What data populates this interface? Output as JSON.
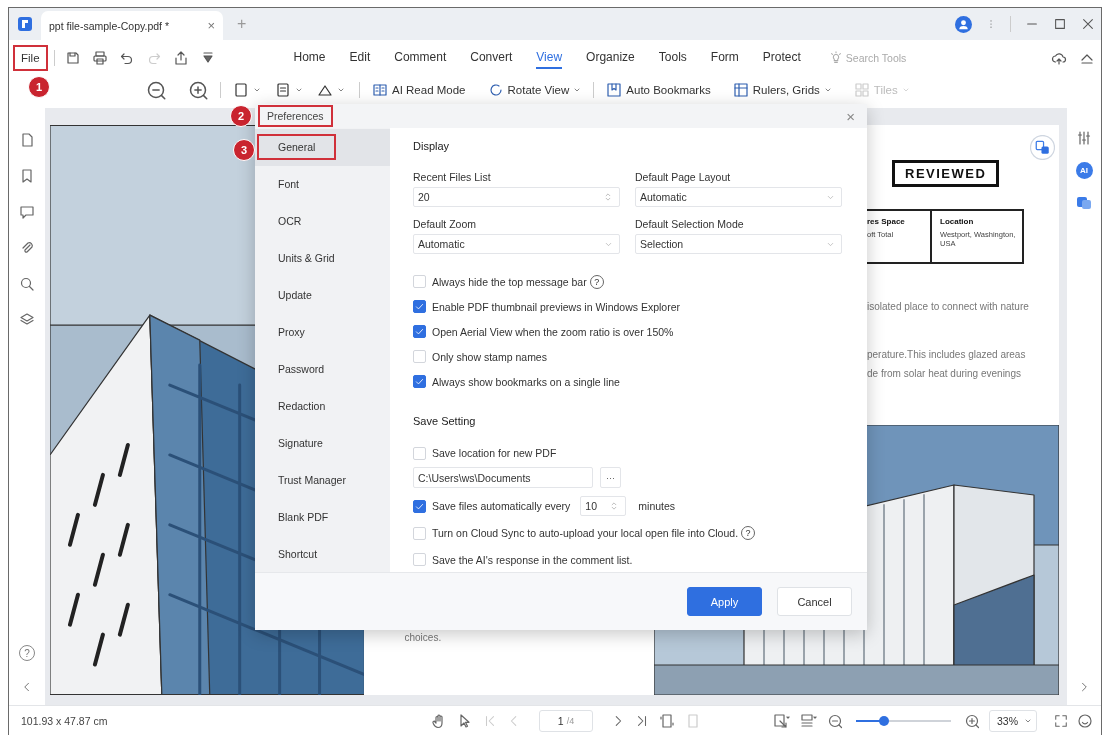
{
  "window": {
    "tab_title": "ppt file-sample-Copy.pdf *",
    "tab_close": "×",
    "new_tab": "+"
  },
  "menu": {
    "file": {
      "label": "File",
      "outlined": true
    },
    "tabs": [
      {
        "label": "Home",
        "selected": false
      },
      {
        "label": "Edit",
        "selected": false
      },
      {
        "label": "Comment",
        "selected": false
      },
      {
        "label": "Convert",
        "selected": false
      },
      {
        "label": "View",
        "selected": true
      },
      {
        "label": "Organize",
        "selected": false
      },
      {
        "label": "Tools",
        "selected": false
      },
      {
        "label": "Form",
        "selected": false
      },
      {
        "label": "Protect",
        "selected": false
      }
    ],
    "search": {
      "placeholder": "Search Tools"
    }
  },
  "toolbar": {
    "items": [
      {
        "label": "AI Read Mode",
        "dropdown": false,
        "disabled": false
      },
      {
        "label": "Rotate View",
        "dropdown": true,
        "disabled": false
      },
      {
        "label": "Auto Bookmarks",
        "dropdown": false,
        "disabled": false
      },
      {
        "label": "Rulers, Grids",
        "dropdown": true,
        "disabled": false
      },
      {
        "label": "Tiles",
        "dropdown": true,
        "disabled": true
      }
    ]
  },
  "callouts": [
    {
      "label": "1"
    },
    {
      "label": "2"
    },
    {
      "label": "3"
    }
  ],
  "left_rail": {
    "help": "?"
  },
  "right_rail": {
    "ai_badge": "AI"
  },
  "document": {
    "stamp": "REVIEWED",
    "table": [
      {
        "heading": "res Space",
        "value": "oft Total"
      },
      {
        "heading": "Location",
        "value": "Westport, Washington, USA"
      }
    ],
    "lines": [
      "isolated place to connect with nature",
      "perature.This includes glazed areas",
      "de from solar heat during evenings"
    ],
    "footer_text": "choices."
  },
  "dialog": {
    "title": "Preferences",
    "title_outlined": true,
    "close": "×",
    "nav": [
      {
        "label": "General",
        "selected": true,
        "outlined": true
      },
      {
        "label": "Font",
        "selected": false,
        "outlined": false
      },
      {
        "label": "OCR",
        "selected": false,
        "outlined": false
      },
      {
        "label": "Units & Grid",
        "selected": false,
        "outlined": false
      },
      {
        "label": "Update",
        "selected": false,
        "outlined": false
      },
      {
        "label": "Proxy",
        "selected": false,
        "outlined": false
      },
      {
        "label": "Password",
        "selected": false,
        "outlined": false
      },
      {
        "label": "Redaction",
        "selected": false,
        "outlined": false
      },
      {
        "label": "Signature",
        "selected": false,
        "outlined": false
      },
      {
        "label": "Trust Manager",
        "selected": false,
        "outlined": false
      },
      {
        "label": "Blank PDF",
        "selected": false,
        "outlined": false
      },
      {
        "label": "Shortcut",
        "selected": false,
        "outlined": false
      }
    ],
    "display": {
      "heading": "Display",
      "fields": [
        {
          "label": "Recent Files List",
          "value": "20",
          "kind": "spinner"
        },
        {
          "label": "Default Page Layout",
          "value": "Automatic",
          "kind": "dropdown"
        },
        {
          "label": "Default Zoom",
          "value": "Automatic",
          "kind": "dropdown"
        },
        {
          "label": "Default Selection Mode",
          "value": "Selection",
          "kind": "dropdown"
        }
      ],
      "options": [
        {
          "label": "Always hide the top message bar",
          "checked": false,
          "help": "?"
        },
        {
          "label": "Enable PDF thumbnail previews in Windows Explorer",
          "checked": true
        },
        {
          "label": "Open Aerial View when the zoom ratio is over 150%",
          "checked": true
        },
        {
          "label": "Only show stamp names",
          "checked": false
        },
        {
          "label": "Always show bookmarks on a single line",
          "checked": true
        }
      ]
    },
    "save": {
      "heading": "Save Setting",
      "items": [
        {
          "kind": "checkbox",
          "label": "Save location for new PDF",
          "checked": false
        },
        {
          "kind": "path",
          "value": "C:\\Users\\ws\\Documents",
          "browse": "···"
        },
        {
          "kind": "autosave",
          "label": "Save files automatically every",
          "checked": true,
          "value": "10",
          "unit": "minutes"
        },
        {
          "kind": "checkbox",
          "label": "Turn on Cloud Sync to auto-upload your local open file into Cloud.",
          "checked": false,
          "help": "?"
        },
        {
          "kind": "checkbox",
          "label": "Save the AI's response in the comment list.",
          "checked": false
        }
      ]
    },
    "buttons": [
      {
        "label": "Apply",
        "kind": "primary"
      },
      {
        "label": "Cancel",
        "kind": "secondary"
      }
    ]
  },
  "status_bar": {
    "dimensions": "101.93 x 47.87 cm",
    "page": "1",
    "page_count": "/4",
    "zoom_slider": {
      "level": 0.3
    },
    "zoom": "33%"
  }
}
